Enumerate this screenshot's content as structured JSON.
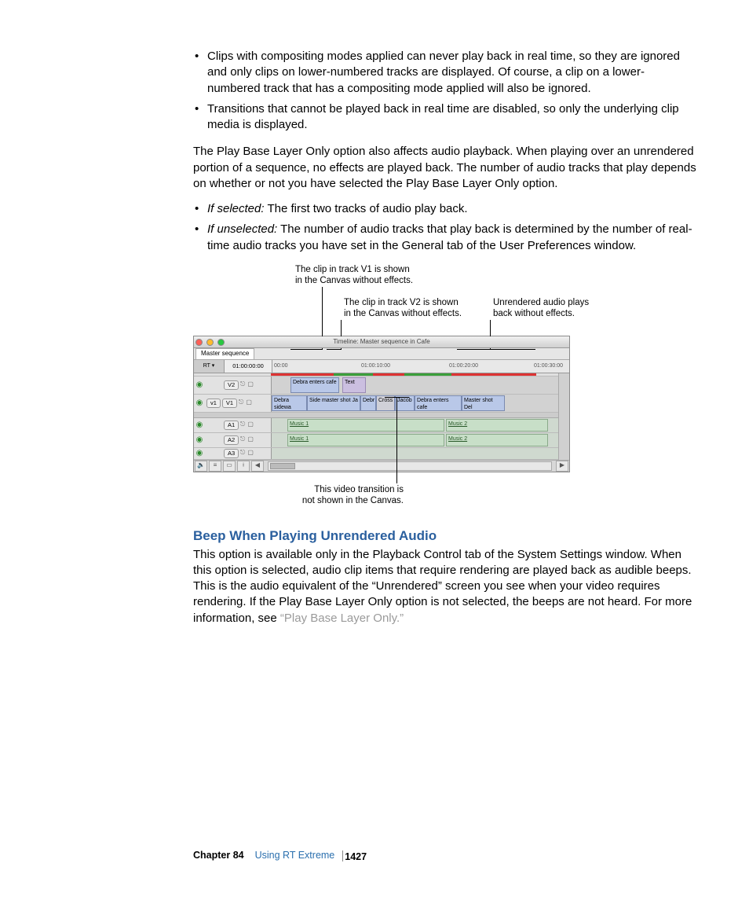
{
  "bullets_top": [
    "Clips with compositing modes applied can never play back in real time, so they are ignored and only clips on lower-numbered tracks are displayed. Of course, a clip on a lower-numbered track that has a compositing mode applied will also be ignored.",
    "Transitions that cannot be played back in real time are disabled, so only the underlying clip media is displayed."
  ],
  "para_mid": "The Play Base Layer Only option also affects audio playback. When playing over an unrendered portion of a sequence, no effects are played back. The number of audio tracks that play depends on whether or not you have selected the Play Base Layer Only option.",
  "bullets_mid": [
    {
      "lead": "If selected:",
      "rest": "  The first two tracks of audio play back."
    },
    {
      "lead": "If unselected:",
      "rest": "  The number of audio tracks that play back is determined by the number of real-time audio tracks you have set in the General tab of the User Preferences window."
    }
  ],
  "callouts": {
    "c1a": "The clip in track V1 is shown",
    "c1b": "in the Canvas without effects.",
    "c2a": "The clip in track V2 is shown",
    "c2b": "in the Canvas without effects.",
    "c3a": "Unrendered audio plays",
    "c3b": "back without effects.",
    "b1a": "This video transition is",
    "b1b": "not shown in the Canvas."
  },
  "timeline": {
    "title": "Timeline: Master sequence in Cafe",
    "tab": "Master sequence",
    "rt": "RT ▾",
    "tc": "01:00:00:00",
    "ticks": [
      "00:00",
      "01:00:10:00",
      "01:00:20:00",
      "01:00:30:00"
    ],
    "tracks": {
      "v2": "V2",
      "v1_src": "v1",
      "v1": "V1",
      "a1": "A1",
      "a2": "A2",
      "a3": "A3"
    },
    "clips": {
      "v2_1": "Debra enters cafe",
      "v2_2": "Text",
      "v1_1": "Debra sidewa",
      "v1_2": "Side master shot Ja",
      "v1_3": "Debr",
      "v1_4": "Cross",
      "v1_5": "Jacob",
      "v1_6": "Debra enters cafe",
      "v1_7": "Master shot Del",
      "a_m1": "Music 1",
      "a_m2": "Music 2"
    }
  },
  "heading": "Beep When Playing Unrendered Audio",
  "para_end": "This option is available only in the Playback Control tab of the System Settings window. When this option is selected, audio clip items that require rendering are played back as audible beeps. This is the audio equivalent of the “Unrendered” screen you see when your video requires rendering. If the Play Base Layer Only option is not selected, the beeps are not heard. For more information, see ",
  "link_end": "“Play Base Layer Only.”",
  "footer": {
    "chapter": "Chapter 84",
    "title": "Using RT Extreme",
    "page": "1427"
  }
}
